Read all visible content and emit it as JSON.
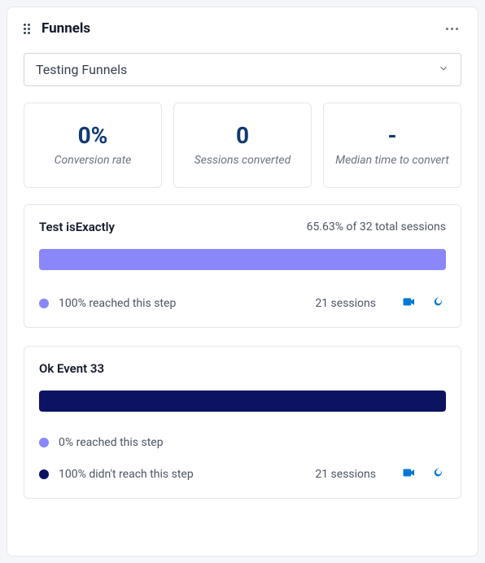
{
  "header": {
    "title": "Funnels"
  },
  "select": {
    "label": "Testing Funnels"
  },
  "stats": {
    "conversion_rate": {
      "value": "0%",
      "label": "Conversion rate"
    },
    "sessions_converted": {
      "value": "0",
      "label": "Sessions converted"
    },
    "median_time": {
      "value": "-",
      "label": "Median time to convert"
    }
  },
  "chart_data": {
    "type": "bar",
    "total_sessions": 32,
    "series": [
      {
        "name": "reached",
        "color": "#8a87fa"
      },
      {
        "name": "did_not_reach",
        "color": "#0c1361"
      }
    ],
    "steps": [
      {
        "name": "Test isExactly",
        "meta": "65.63% of 32 total sessions",
        "reached_pct": 100,
        "did_not_reach_pct": 0,
        "sessions": 21
      },
      {
        "name": "Ok Event 33",
        "meta": "",
        "reached_pct": 0,
        "did_not_reach_pct": 100,
        "sessions": 21
      }
    ]
  },
  "steps": [
    {
      "name": "Test isExactly",
      "meta": "65.63% of 32 total sessions",
      "bar_class": "bar-purple",
      "rows": [
        {
          "dot": "dot-purple",
          "text": "100% reached this step",
          "sessions": "21 sessions",
          "actions": true
        }
      ]
    },
    {
      "name": "Ok Event 33",
      "meta": "",
      "bar_class": "bar-navy",
      "rows": [
        {
          "dot": "dot-purple",
          "text": "0% reached this step",
          "sessions": "",
          "actions": false
        },
        {
          "dot": "dot-navy",
          "text": "100% didn't reach this step",
          "sessions": "21 sessions",
          "actions": true
        }
      ]
    }
  ]
}
